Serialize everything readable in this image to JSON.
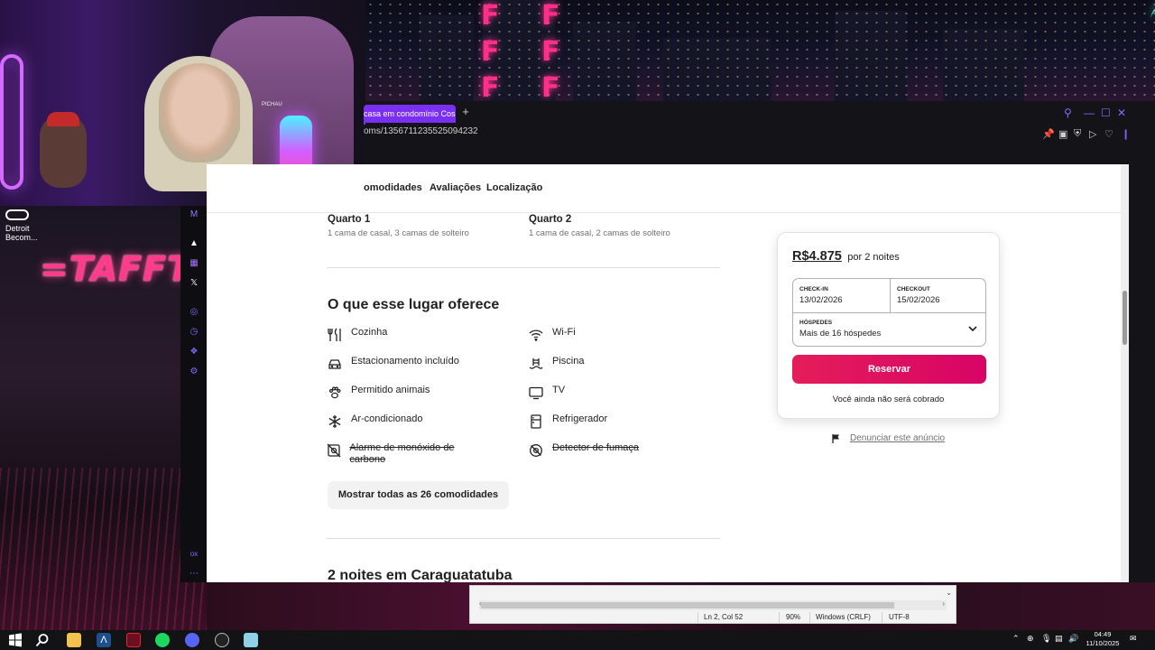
{
  "browser": {
    "tab_title": "casa em condomínio Cos",
    "url": "oms/1356711235525094232"
  },
  "nav": {
    "amenities": "omodidades",
    "reviews": "Avaliações",
    "location": "Localização"
  },
  "rooms": [
    {
      "title": "Quarto 1",
      "desc": "1 cama de casal, 3 camas de solteiro"
    },
    {
      "title": "Quarto 2",
      "desc": "1 cama de casal, 2 camas de solteiro"
    }
  ],
  "offers": {
    "heading": "O que esse lugar oferece",
    "left": [
      {
        "label": "Cozinha",
        "icon": "kitchen-icon",
        "unavailable": false
      },
      {
        "label": "Estacionamento incluído",
        "icon": "car-icon",
        "unavailable": false
      },
      {
        "label": "Permitido animais",
        "icon": "paw-icon",
        "unavailable": false
      },
      {
        "label": "Ar-condicionado",
        "icon": "snowflake-icon",
        "unavailable": false
      },
      {
        "label": "Alarme de monóxido de carbono",
        "icon": "co-alarm-icon",
        "unavailable": true
      }
    ],
    "right": [
      {
        "label": "Wi-Fi",
        "icon": "wifi-icon",
        "unavailable": false
      },
      {
        "label": "Piscina",
        "icon": "pool-icon",
        "unavailable": false
      },
      {
        "label": "TV",
        "icon": "tv-icon",
        "unavailable": false
      },
      {
        "label": "Refrigerador",
        "icon": "fridge-icon",
        "unavailable": false
      },
      {
        "label": "Detector de fumaça",
        "icon": "smoke-detector-icon",
        "unavailable": true
      }
    ],
    "show_all": "Mostrar todas as 26 comodidades"
  },
  "next_section": "2 noites em Caraguatatuba",
  "booking": {
    "price": "R$4.875",
    "per": "por 2 noites",
    "checkin_label": "CHECK-IN",
    "checkin_value": "13/02/2026",
    "checkout_label": "CHECKOUT",
    "checkout_value": "15/02/2026",
    "guests_label": "HÓSPEDES",
    "guests_value": "Mais de 16 hóspedes",
    "reserve": "Reservar",
    "no_charge": "Você ainda não será cobrado",
    "report": "Denunciar este anúncio",
    "accent": "#E31C5F"
  },
  "desktop": {
    "icon_label": "Detroit Becom...",
    "neon_text": "=TAFFTUN",
    "chair_brand": "PICHAU"
  },
  "notepad": {
    "position": "Ln 2, Col 52",
    "zoom": "90%",
    "line_ending": "Windows (CRLF)",
    "encoding": "UTF-8"
  },
  "taskbar": {
    "time": "04:49",
    "date": "11/10/2025"
  }
}
